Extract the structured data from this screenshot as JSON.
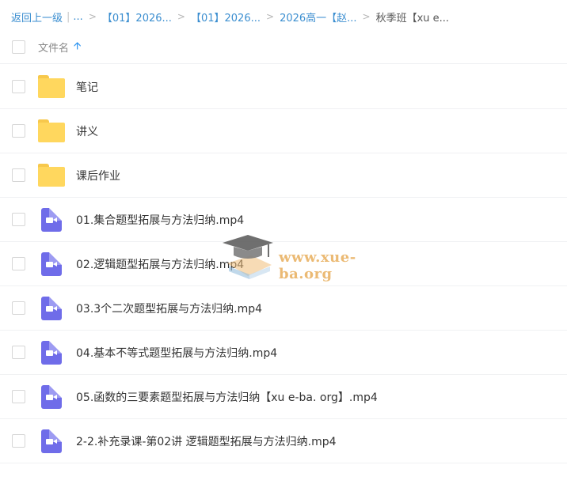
{
  "breadcrumb": {
    "back_label": "返回上一级",
    "ellipsis": "...",
    "items": [
      "【01】2026...",
      "【01】2026...",
      "2026高一【赵..."
    ],
    "current": "秋季班【xu e..."
  },
  "list_header": {
    "column_label": "文件名",
    "sort_icon": "arrow-up-icon"
  },
  "files": [
    {
      "name": "笔记",
      "type": "folder"
    },
    {
      "name": "讲义",
      "type": "folder"
    },
    {
      "name": "课后作业",
      "type": "folder"
    },
    {
      "name": "01.集合题型拓展与方法归纳.mp4",
      "type": "video"
    },
    {
      "name": "02.逻辑题型拓展与方法归纳.mp4",
      "type": "video"
    },
    {
      "name": "03.3个二次题型拓展与方法归纳.mp4",
      "type": "video"
    },
    {
      "name": "04.基本不等式题型拓展与方法归纳.mp4",
      "type": "video"
    },
    {
      "name": "05.函数的三要素题型拓展与方法归纳【xu e-ba. org】.mp4",
      "type": "video"
    },
    {
      "name": "2-2.补充录课-第02讲 逻辑题型拓展与方法归纳.mp4",
      "type": "video"
    }
  ],
  "watermark": {
    "text": "www.xue-ba.org"
  },
  "colors": {
    "link": "#3b8ed0",
    "sort_arrow": "#2a93f0",
    "folder": "#ffd75e",
    "video": "#6f6ce9"
  }
}
